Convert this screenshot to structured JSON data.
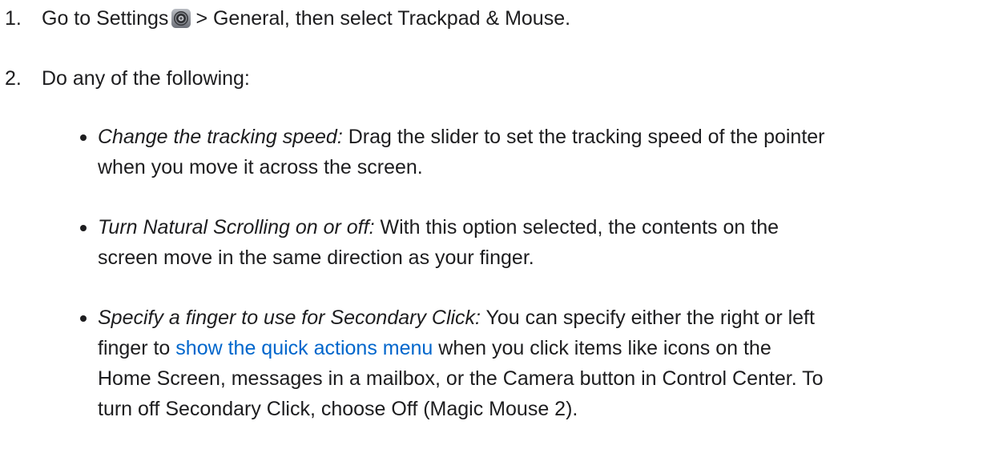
{
  "steps": [
    {
      "number": "1.",
      "before_icon": "Go to Settings",
      "icon": "settings-gear-icon",
      "after_icon": "> General, then select Trackpad & Mouse."
    },
    {
      "number": "2.",
      "text": "Do any of the following:"
    }
  ],
  "bullets": [
    {
      "term": "Change the tracking speed:",
      "line1": "Drag the slider to set the tracking speed of the pointer",
      "line2": "when you move it across the screen."
    },
    {
      "term": "Turn Natural Scrolling on or off:",
      "line1": "With this option selected, the contents on the",
      "line2": "screen move in the same direction as your finger."
    },
    {
      "term": "Specify a finger to use for Secondary Click:",
      "line1": "You can specify either the right or left",
      "line2_pre": "finger to",
      "link": "show the quick actions menu",
      "line2_post": "when you click items like icons on the",
      "line3": "Home Screen, messages in a mailbox, or the Camera button in Control Center. To",
      "line4": "turn off Secondary Click, choose Off (Magic Mouse 2)."
    }
  ],
  "colors": {
    "text": "#1d1d1f",
    "link": "#0066cc"
  }
}
